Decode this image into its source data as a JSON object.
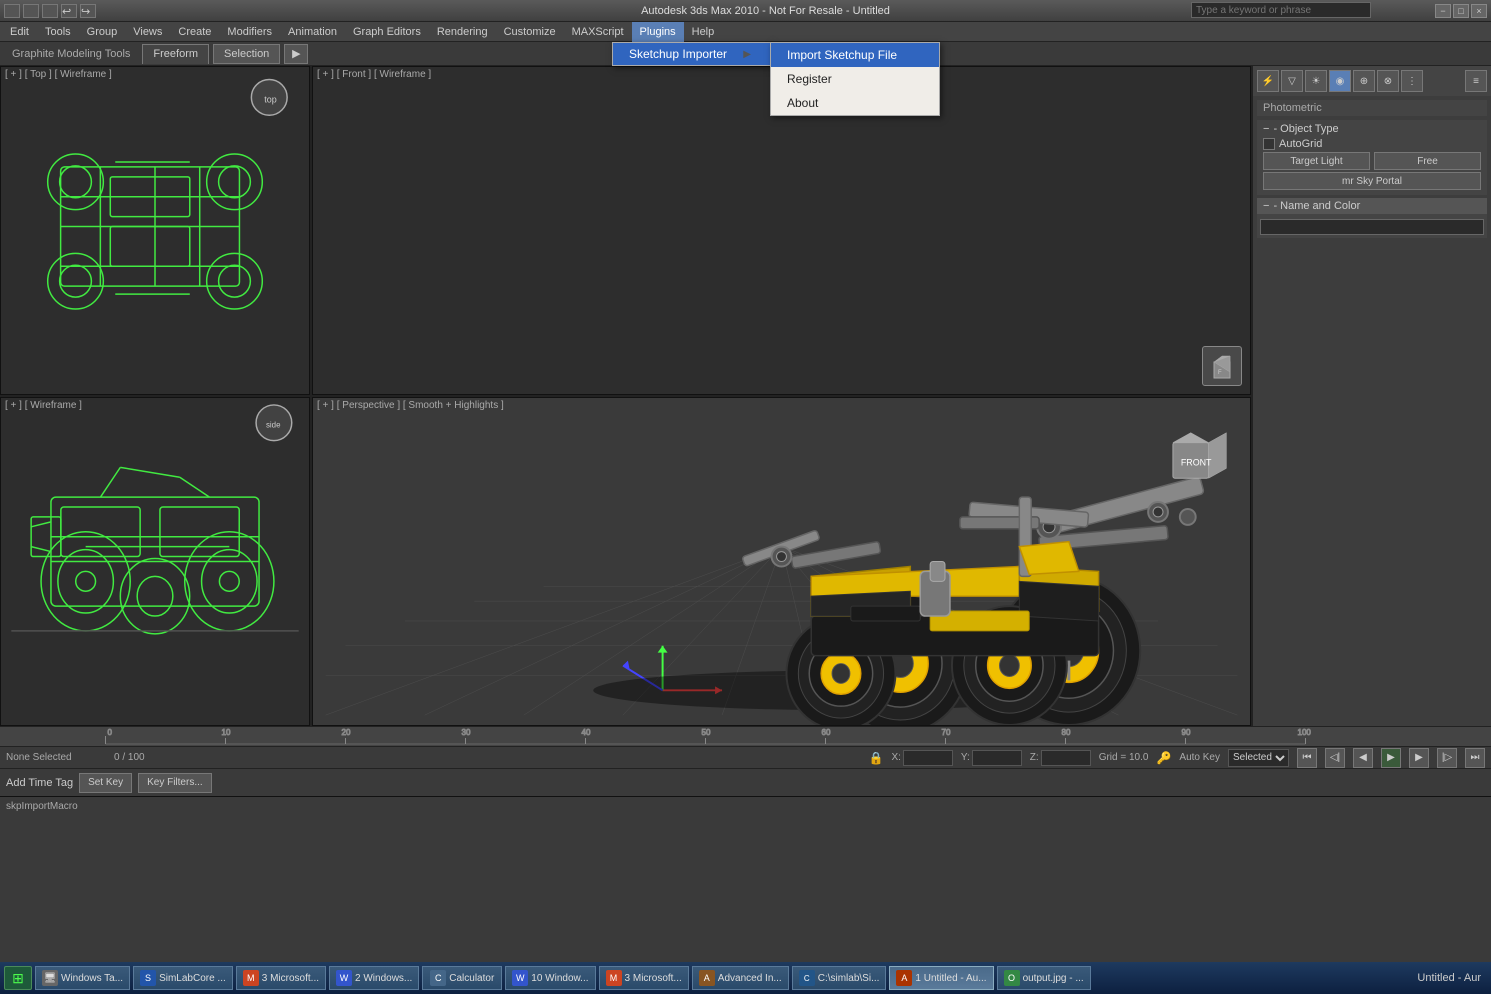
{
  "titleBar": {
    "title": "Autodesk 3ds Max 2010 - Not For Resale - Untitled",
    "minLabel": "−",
    "maxLabel": "□",
    "closeLabel": "×"
  },
  "searchBar": {
    "placeholder": "Type a keyword or phrase"
  },
  "menuBar": {
    "items": [
      {
        "id": "edit",
        "label": "Edit"
      },
      {
        "id": "tools",
        "label": "Tools"
      },
      {
        "id": "group",
        "label": "Group"
      },
      {
        "id": "views",
        "label": "Views"
      },
      {
        "id": "create",
        "label": "Create"
      },
      {
        "id": "modifiers",
        "label": "Modifiers"
      },
      {
        "id": "animation",
        "label": "Animation"
      },
      {
        "id": "grapheditors",
        "label": "Graph Editors"
      },
      {
        "id": "rendering",
        "label": "Rendering"
      },
      {
        "id": "customize",
        "label": "Customize"
      },
      {
        "id": "maxscript",
        "label": "MAXScript"
      },
      {
        "id": "plugins",
        "label": "Plugins"
      },
      {
        "id": "help",
        "label": "Help"
      }
    ]
  },
  "toolbar": {
    "modelingLabel": "Graphite Modeling Tools",
    "tabs": [
      "Freeform",
      "Selection"
    ],
    "videoIcon": "▶"
  },
  "modelingBar": {
    "label": "Graphite Modeling Tools",
    "tabs": [
      {
        "label": "Freeform"
      },
      {
        "label": "Selection"
      }
    ]
  },
  "viewports": {
    "topLeft": {
      "label": "[ + ] [ Top ] [ Wireframe ]"
    },
    "topRight": {
      "label": "[ + ] [ Front ] [ Wireframe ]"
    },
    "bottomLeft": {
      "label": "[ + ] [ Wireframe ]"
    },
    "bottomRight": {
      "label": "[ + ] [ Perspective ] [ Smooth + Highlights ]"
    }
  },
  "pluginsMenu": {
    "items": [
      {
        "label": "Sketchup Importer",
        "hasSubmenu": true
      }
    ]
  },
  "sketchupSubmenu": {
    "items": [
      {
        "label": "Import Sketchup File",
        "active": true
      },
      {
        "label": "Register"
      },
      {
        "label": "About"
      }
    ]
  },
  "rightPanel": {
    "photometricLabel": "Photometric",
    "objectTypeHeader": "- Object Type",
    "autoGridLabel": "AutoGrid",
    "targetLightBtn": "Target Light",
    "freeLabel": "Free",
    "mrSkyPortalBtn": "mr Sky Portal",
    "nameAndColorHeader": "- Name and Color"
  },
  "statusBar": {
    "statusText": "None Selected",
    "progressText": "0 / 100",
    "xLabel": "X:",
    "yLabel": "Y:",
    "zLabel": "Z:",
    "gridLabel": "Grid = 10.0",
    "autoKeyLabel": "Auto Key",
    "autoKeyValue": "Selected",
    "addTimeTagLabel": "Add Time Tag",
    "setKeyLabel": "Set Key",
    "keyFiltersLabel": "Key Filters..."
  },
  "macroBar": {
    "text": "skpImportMacro"
  },
  "timelineBar": {
    "frameStart": "0",
    "frameEnd": "100",
    "ticks": [
      "0",
      "10",
      "20",
      "30",
      "40",
      "50",
      "60",
      "70",
      "80",
      "90",
      "100"
    ]
  },
  "animControls": {
    "prevKeyBtn": "⏮",
    "prevFrameBtn": "◀",
    "playBtn": "▶",
    "nextFrameBtn": "▶",
    "nextKeyBtn": "⏭",
    "stopBtn": "⏹"
  },
  "taskbar": {
    "startBtn": "⊞",
    "items": [
      {
        "label": "Windows Ta...",
        "icon": "🖥"
      },
      {
        "label": "SimLabCore ...",
        "icon": "S"
      },
      {
        "label": "3 Microsoft...",
        "icon": "M"
      },
      {
        "label": "2 Windows...",
        "icon": "W"
      },
      {
        "label": "Calculator",
        "icon": "C"
      },
      {
        "label": "10 Window...",
        "icon": "W"
      },
      {
        "label": "3 Microsoft...",
        "icon": "M"
      },
      {
        "label": "Advanced In...",
        "icon": "A"
      },
      {
        "label": "C:\\simlab\\Si...",
        "icon": "C"
      },
      {
        "label": "1 Untitled - Au...",
        "icon": "A",
        "active": true
      },
      {
        "label": "output.jpg - ...",
        "icon": "O"
      }
    ]
  },
  "colors": {
    "wireframeGreen": "#44ff44",
    "menubarBg": "#444444",
    "dropdownBg": "#f0ede8",
    "activeBlue": "#3065bf",
    "viewportBg": "#2d2d2d",
    "perspectiveBg": "#3a3a3a",
    "accent": "#5a7fb5"
  }
}
